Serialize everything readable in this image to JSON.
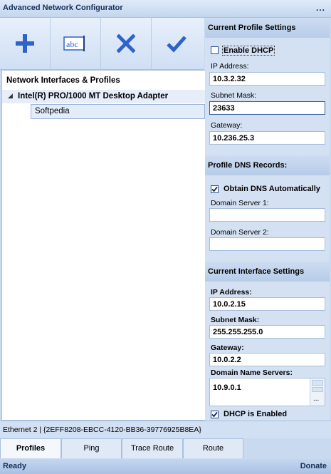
{
  "window": {
    "title": "Advanced Network Configurator",
    "menu_glyph": "..."
  },
  "toolbar": {
    "buttons": [
      {
        "name": "add",
        "icon": "plus-icon"
      },
      {
        "name": "rename",
        "icon": "rename-icon",
        "icon_text": "abc"
      },
      {
        "name": "delete",
        "icon": "x-icon"
      },
      {
        "name": "apply",
        "icon": "checkmark-icon"
      }
    ]
  },
  "tree": {
    "heading": "Network Interfaces & Profiles",
    "adapter": "Intel(R) PRO/1000 MT Desktop Adapter",
    "profile": "Softpedia"
  },
  "profile_settings": {
    "header": "Current Profile Settings",
    "enable_dhcp_label": "Enable DHCP",
    "enable_dhcp_checked": false,
    "ip_label": "IP Address:",
    "ip_value": "10.3.2.32",
    "mask_label": "Subnet Mask:",
    "mask_value": "23633",
    "gateway_label": "Gateway:",
    "gateway_value": "10.236.25.3"
  },
  "dns": {
    "header": "Profile DNS Records:",
    "obtain_label": "Obtain DNS Automatically",
    "obtain_checked": true,
    "server1_label": "Domain Server 1:",
    "server1_value": "",
    "server2_label": "Domain Server 2:",
    "server2_value": ""
  },
  "interface_settings": {
    "header": "Current Interface Settings",
    "ip_label": "IP Address:",
    "ip_value": "10.0.2.15",
    "mask_label": "Subnet Mask:",
    "mask_value": "255.255.255.0",
    "gateway_label": "Gateway:",
    "gateway_value": "10.0.2.2",
    "dns_label": "Domain Name Servers:",
    "dns_value": "10.9.0.1",
    "ellipsis": "...",
    "dhcp_label": "DHCP is Enabled",
    "dhcp_checked": true
  },
  "info_bar": "Ethernet 2 | {2EFF8208-EBCC-4120-BB36-39776925B8EA}",
  "tabs": [
    {
      "label": "Profiles",
      "active": true
    },
    {
      "label": "Ping",
      "active": false
    },
    {
      "label": "Trace Route",
      "active": false
    },
    {
      "label": "Route",
      "active": false
    }
  ],
  "status": {
    "left": "Ready",
    "right": "Donate"
  },
  "colors": {
    "accent": "#2f63c8",
    "header": "#b7cce9",
    "status": "#a9c1e4"
  }
}
